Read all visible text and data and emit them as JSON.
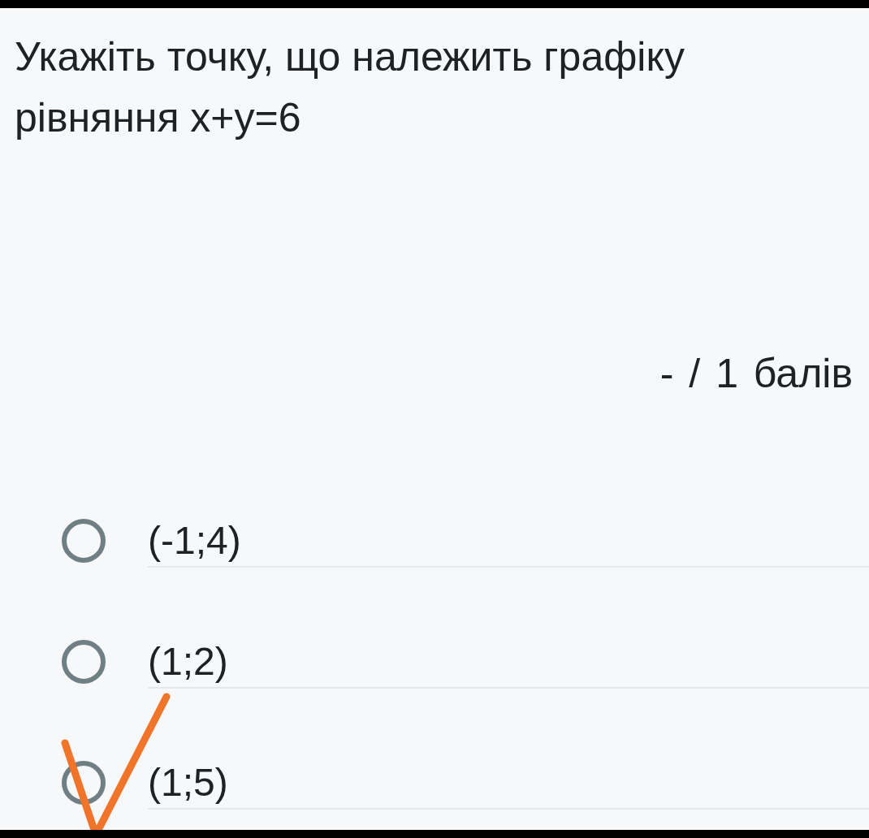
{
  "question": {
    "text": "Укажіть точку, що належить графіку рівняння x+y=6",
    "points": "- / 1 балів"
  },
  "options": [
    {
      "label": "(-1;4)",
      "selected": false,
      "marked": false
    },
    {
      "label": "(1;2)",
      "selected": false,
      "marked": false
    },
    {
      "label": "(1;5)",
      "selected": false,
      "marked": true
    }
  ]
}
